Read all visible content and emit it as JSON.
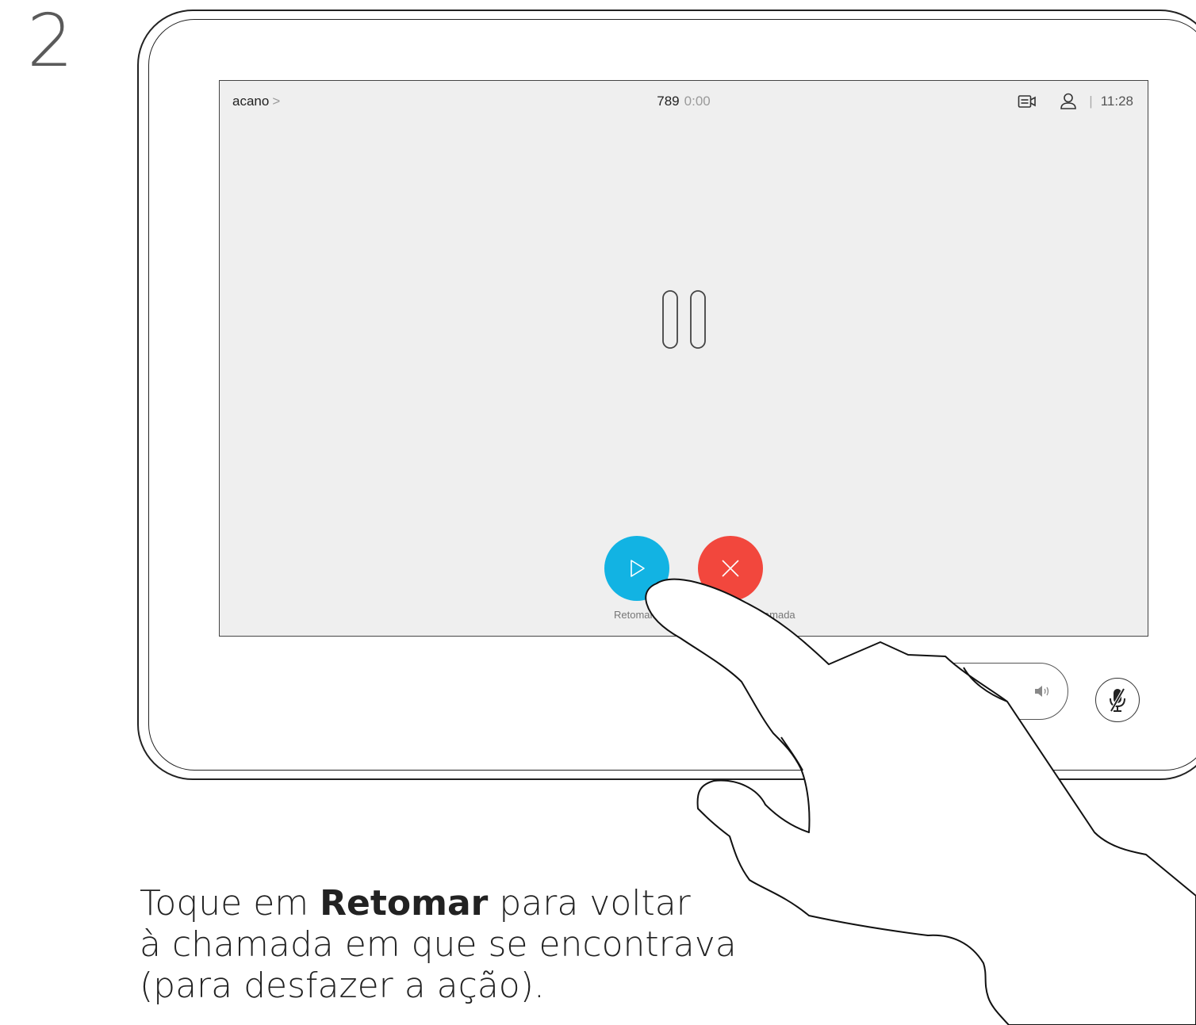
{
  "step": {
    "number": "2"
  },
  "screen": {
    "caller_name": "acano",
    "caller_chevron": ">",
    "call_number": "789",
    "call_timer": "0:00",
    "separator": "|",
    "clock": "11:28",
    "actions": [
      {
        "label": "Retomar",
        "icon": "play-icon",
        "color": "#12b3e3"
      },
      {
        "label": "Terminar chamada",
        "icon": "close-icon",
        "color": "#f2473d"
      }
    ]
  },
  "controls": {
    "volume_icon": "speaker-icon",
    "mute_icon": "microphone-muted-icon"
  },
  "instruction": {
    "prefix": "Toque em ",
    "emphasis": "Retomar",
    "line1_rest": " para voltar",
    "line2": "à chamada em que se encontrava",
    "line3": "(para desfazer a ação)."
  }
}
